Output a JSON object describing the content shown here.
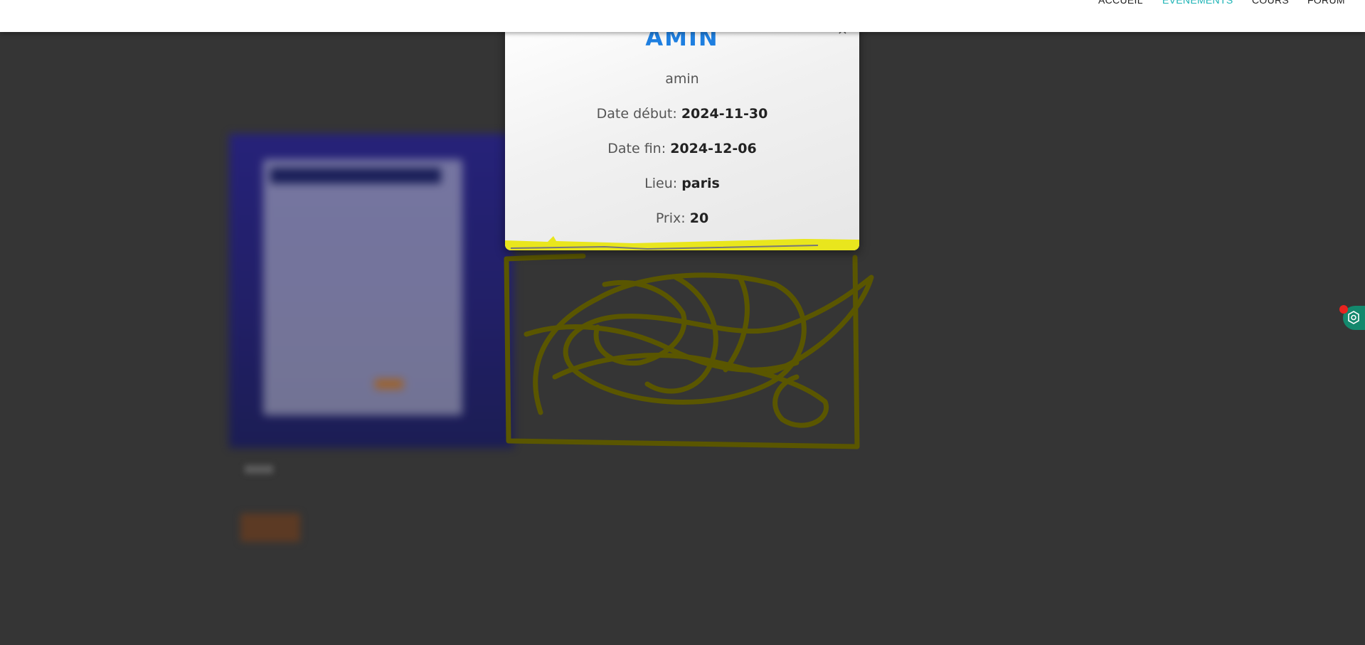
{
  "nav": {
    "items": [
      "ACCUEIL",
      "ÉVÉNEMENTS",
      "COURS",
      "FORUM"
    ],
    "active": "ÉVÉNEMENTS"
  },
  "modal": {
    "close": "×",
    "title": "AMIN",
    "subtitle": "amin",
    "rows": [
      {
        "label": "Date début:",
        "value": "2024-11-30"
      },
      {
        "label": "Date fin:",
        "value": "2024-12-06"
      },
      {
        "label": "Lieu:",
        "value": "paris"
      },
      {
        "label": "Prix:",
        "value": "20"
      }
    ]
  },
  "icons": {
    "close": "close-icon",
    "widget": "hexagon-settings-icon"
  },
  "colors": {
    "accent": "#1bb3b5",
    "title": "#1e7fe0",
    "highlight": "#e9e61d",
    "scribble": "#5a5600",
    "widget": "#13886d",
    "notification": "#e8231f",
    "backdrop": "#353535"
  }
}
